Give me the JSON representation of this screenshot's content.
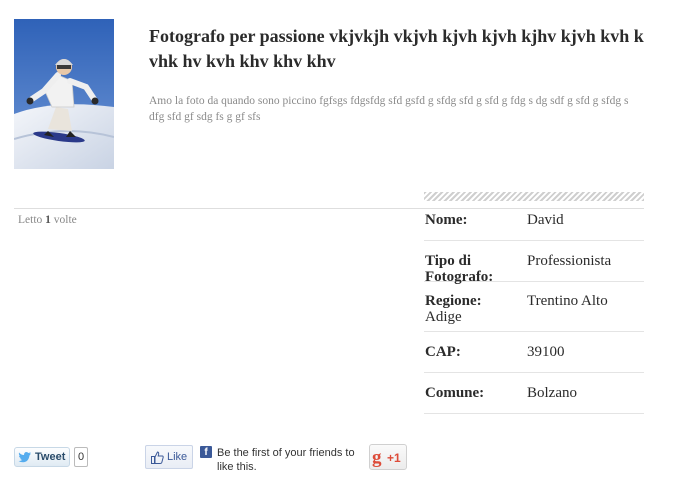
{
  "article": {
    "title": "Fotografo per passione vkjvkjh vkjvh kjvh kjvh kjhv kjvh kvh k vhk hv kvh khv khv khv",
    "description": "Amo la foto da quando sono piccino fgfsgs fdgsfdg sfd gsfd g sfdg sfd g sfd g fdg s dg sdf g sfd g sfdg s dfg sfd gf sdg fs g gf sfs",
    "hits_prefix": "Letto",
    "hits_count": "1",
    "hits_suffix": "volte"
  },
  "profile": {
    "rows": [
      {
        "label": "Nome:",
        "value": "David"
      },
      {
        "label": "Tipo di Fotografo:",
        "value": "Professionista"
      },
      {
        "label": "Regione:",
        "value": "Trentino Alto",
        "value_cont": "Adige"
      },
      {
        "label": "CAP:",
        "value": "39100"
      },
      {
        "label": "Comune:",
        "value": "Bolzano"
      }
    ]
  },
  "social": {
    "tweet_label": "Tweet",
    "tweet_count": "0",
    "like_label": "Like",
    "fb_text": "Be the first of your friends to like this.",
    "gplus_label": "+1"
  },
  "colors": {
    "facebook": "#3b5998",
    "gplus": "#dd4b39",
    "twitter": "#2a4c6b"
  },
  "icons": [
    "twitter-bird-icon",
    "thumbs-up-icon",
    "facebook-icon",
    "google-plus-icon"
  ]
}
